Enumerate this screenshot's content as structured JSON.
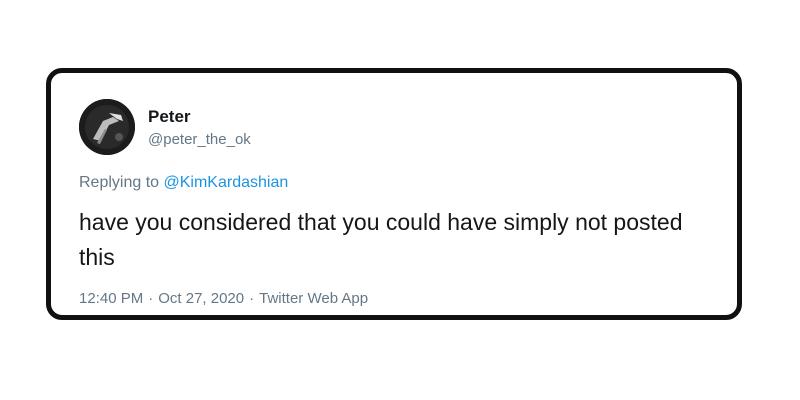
{
  "user": {
    "name": "Peter",
    "handle": "@peter_the_ok"
  },
  "reply": {
    "prefix": "Replying to ",
    "mention": "@KimKardashian"
  },
  "tweet": {
    "text": "have you considered that you could have simply not posted this"
  },
  "meta": {
    "time": "12:40 PM",
    "date": "Oct 27, 2020",
    "source": "Twitter Web App",
    "separator": "·"
  },
  "colors": {
    "link": "#1b95e0",
    "muted": "#657786",
    "text": "#14171a",
    "border": "#111111"
  },
  "icons": {
    "avatar": "profile-photo"
  }
}
